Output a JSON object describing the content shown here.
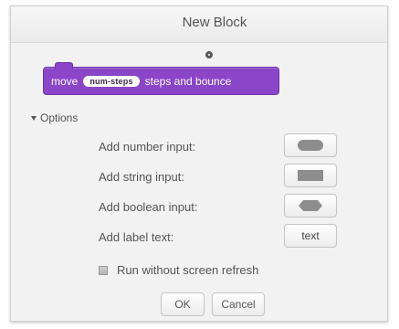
{
  "dialog": {
    "title": "New Block"
  },
  "block": {
    "words": [
      "move",
      "steps and bounce"
    ],
    "param": "num-steps",
    "color": "#8a45c9"
  },
  "options": {
    "toggle_label": "Options",
    "rows": [
      {
        "label": "Add number input:",
        "button_icon": "number-input-shape-icon"
      },
      {
        "label": "Add string input:",
        "button_icon": "string-input-shape-icon"
      },
      {
        "label": "Add boolean input:",
        "button_icon": "boolean-input-shape-icon"
      },
      {
        "label": "Add label text:",
        "button_text": "text"
      }
    ],
    "checkbox_label": "Run without screen refresh",
    "checkbox_checked": false
  },
  "footer": {
    "ok_label": "OK",
    "cancel_label": "Cancel"
  }
}
